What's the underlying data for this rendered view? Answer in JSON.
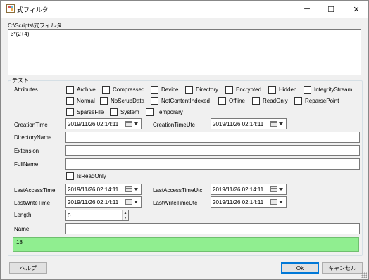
{
  "window": {
    "title": "式フィルタ",
    "controls": {
      "minimize": "─",
      "maximize": "☐",
      "close": "✕"
    }
  },
  "expression": {
    "path_label": "C:\\Scripts\\式フィルタ",
    "text": "3*(2+4)"
  },
  "test_group": {
    "title": "テスト",
    "attributes_label": "Attributes",
    "attributes": [
      {
        "label": "Archive",
        "checked": false
      },
      {
        "label": "Compressed",
        "checked": false
      },
      {
        "label": "Device",
        "checked": false
      },
      {
        "label": "Directory",
        "checked": false
      },
      {
        "label": "Encrypted",
        "checked": false
      },
      {
        "label": "Hidden",
        "checked": false
      },
      {
        "label": "IntegrityStream",
        "checked": false
      },
      {
        "label": "Normal",
        "checked": false
      },
      {
        "label": "NoScrubData",
        "checked": false
      },
      {
        "label": "NotContentIndexed",
        "checked": false
      },
      {
        "label": "Offline",
        "checked": false
      },
      {
        "label": "ReadOnly",
        "checked": false
      },
      {
        "label": "ReparsePoint",
        "checked": false
      },
      {
        "label": "SparseFile",
        "checked": false
      },
      {
        "label": "System",
        "checked": false
      },
      {
        "label": "Temporary",
        "checked": false
      }
    ],
    "creation_time": {
      "label": "CreationTime",
      "value": "2019/11/26 02:14:11"
    },
    "creation_time_utc": {
      "label": "CreationTimeUtc",
      "value": "2019/11/26 02:14:11"
    },
    "directory_name": {
      "label": "DirectoryName",
      "value": ""
    },
    "extension": {
      "label": "Extension",
      "value": ""
    },
    "full_name": {
      "label": "FullName",
      "value": ""
    },
    "is_read_only": {
      "label": "IsReadOnly",
      "checked": false
    },
    "last_access_time": {
      "label": "LastAccessTime",
      "value": "2019/11/26 02:14:11"
    },
    "last_access_time_utc": {
      "label": "LastAccessTimeUtc",
      "value": "2019/11/26 02:14:11"
    },
    "last_write_time": {
      "label": "LastWriteTime",
      "value": "2019/11/26 02:14:11"
    },
    "last_write_time_utc": {
      "label": "LastWriteTimeUtc",
      "value": "2019/11/26 02:14:11"
    },
    "length": {
      "label": "Length",
      "value": "0"
    },
    "name": {
      "label": "Name",
      "value": ""
    },
    "result": {
      "value": "18",
      "color": "#90ee90"
    }
  },
  "footer": {
    "help_label": "ヘルプ",
    "ok_label": "Ok",
    "cancel_label": "キャンセル"
  }
}
